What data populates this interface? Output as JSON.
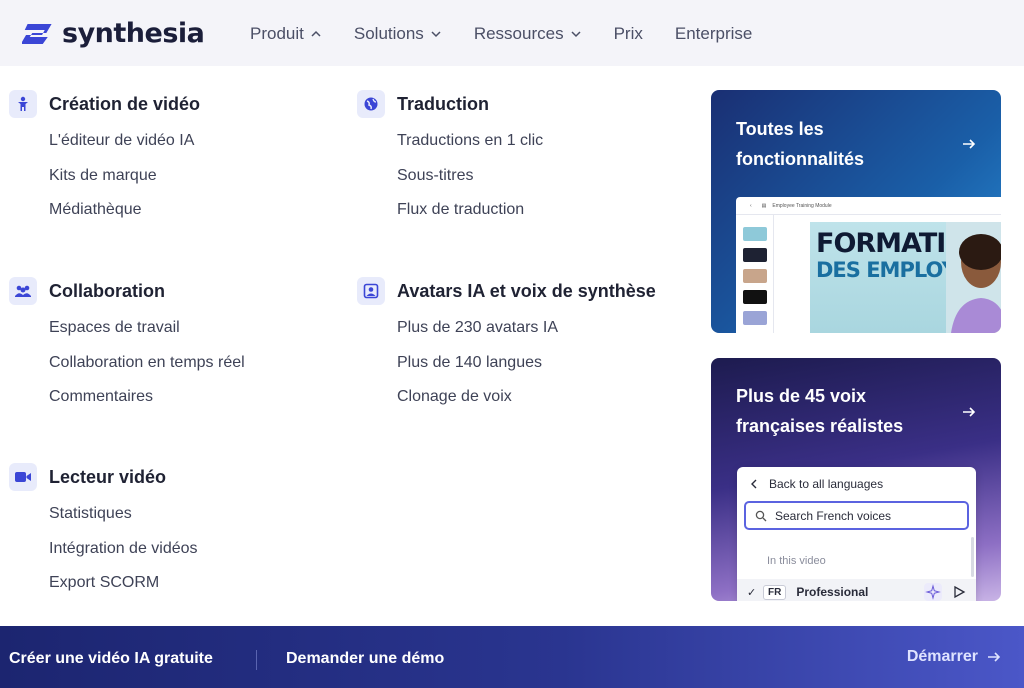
{
  "header": {
    "logo_text": "synthesia",
    "nav": [
      {
        "label": "Produit",
        "expanded": true
      },
      {
        "label": "Solutions",
        "expanded": false
      },
      {
        "label": "Ressources",
        "expanded": false
      },
      {
        "label": "Prix"
      },
      {
        "label": "Enterprise"
      }
    ]
  },
  "menu": {
    "categories": [
      {
        "icon": "person-icon",
        "title": "Création de vidéo",
        "links": [
          "L'éditeur de vidéo IA",
          "Kits de marque",
          "Médiathèque"
        ]
      },
      {
        "icon": "globe-icon",
        "title": "Traduction",
        "links": [
          "Traductions en 1 clic",
          "Sous-titres",
          "Flux de traduction"
        ]
      },
      {
        "icon": "team-icon",
        "title": "Collaboration",
        "links": [
          "Espaces de travail",
          "Collaboration en temps réel",
          "Commentaires"
        ]
      },
      {
        "icon": "avatar-frame-icon",
        "title": "Avatars IA et voix de synthèse",
        "links": [
          "Plus de 230 avatars IA",
          "Plus de 140 langues",
          "Clonage de voix"
        ]
      },
      {
        "icon": "video-camera-icon",
        "title": "Lecteur vidéo",
        "links": [
          "Statistiques",
          "Intégration de vidéos",
          "Export SCORM"
        ]
      }
    ],
    "cards": [
      {
        "title": "Toutes les fonctionnalités",
        "preview": {
          "header_text": "Employee Training Module",
          "headline_1": "FORMATION",
          "headline_2": "DES EMPLOYÉS"
        }
      },
      {
        "title": "Plus de 45 voix françaises réalistes",
        "preview": {
          "back_label": "Back to all languages",
          "search_value": "Search French voices",
          "section_label": "In this video",
          "row_lang": "FR",
          "row_label": "Professional"
        }
      }
    ]
  },
  "footer": {
    "cta_primary": "Créer une vidéo IA gratuite",
    "cta_secondary": "Demander une démo",
    "cta_start": "Démarrer"
  },
  "colors": {
    "brand": "#3b46d6",
    "icon_bg": "#e8ebfb",
    "footer_start": "#1c2570",
    "footer_end": "#4b57c8"
  }
}
